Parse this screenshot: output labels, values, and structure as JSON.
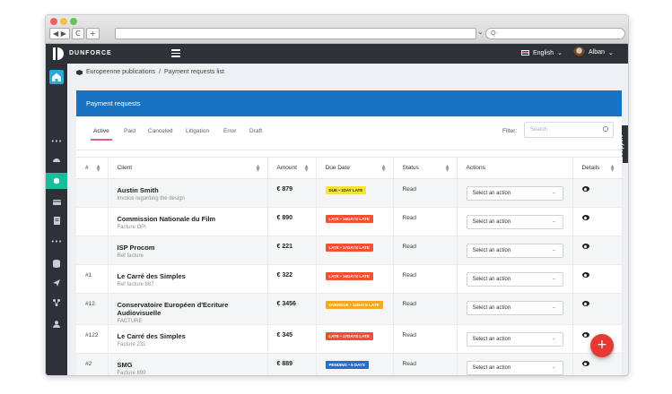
{
  "browser": {
    "back_label": "◀ ▶",
    "reload_label": "C",
    "new_tab_label": "+",
    "url_marker": "⌄",
    "search_placeholder": "Q-"
  },
  "topnav": {
    "brand": "DUNFORCE",
    "language": "English",
    "user": "Alban"
  },
  "sidebar": {
    "items": [
      "home",
      "more",
      "dashboard",
      "publications",
      "billing",
      "documents",
      "more",
      "database",
      "send",
      "network",
      "users"
    ]
  },
  "support": "Support",
  "breadcrumb": {
    "parent": "Europeenne publications",
    "separator": "/",
    "current": "Payment requests list"
  },
  "panel": {
    "title": "Payment requests",
    "tabs": [
      "Active",
      "Paid",
      "Canceled",
      "Litigation",
      "Error",
      "Draft"
    ],
    "active_tab": "Active",
    "filter_label": "Filter:",
    "filter_placeholder": "Search"
  },
  "table": {
    "headers": [
      "#",
      "Client",
      "Amount",
      "Due Date",
      "Status",
      "Actions",
      "Details"
    ],
    "rows": [
      {
        "num": "",
        "client": "Austin Smith",
        "sub": "Invoice regarding the design",
        "amount": "€ 879",
        "due": "DUE • 1DAY LATE",
        "due_color": "#f5e23a",
        "due_text_color": "#333333",
        "status": "Read",
        "action": "Select an action"
      },
      {
        "num": "",
        "client": "Commission Nationale du Film",
        "sub": "Facture OPI",
        "amount": "€ 890",
        "due": "LATE • 16DAYS LATE",
        "due_color": "#f2502e",
        "due_text_color": "#ffffff",
        "status": "Read",
        "action": "Select an action"
      },
      {
        "num": "",
        "client": "ISP Procom",
        "sub": "Ref facture",
        "amount": "€ 221",
        "due": "LATE • 17DAYS LATE",
        "due_color": "#f2502e",
        "due_text_color": "#ffffff",
        "status": "Read",
        "action": "Select an action"
      },
      {
        "num": "#1",
        "client": "Le Carré des Simples",
        "sub": "Ref facture 987",
        "amount": "€ 322",
        "due": "LATE • 16DAYS LATE",
        "due_color": "#f2502e",
        "due_text_color": "#ffffff",
        "status": "Read",
        "action": "Select an action"
      },
      {
        "num": "#12",
        "client": "Conservatoire Européen d'Ecriture Audiovisuelle",
        "sub": "FACTURE",
        "amount": "€ 3456",
        "due": "OVERDUE • 12DAYS LATE",
        "due_color": "#f5a623",
        "due_text_color": "#ffffff",
        "status": "Read",
        "action": "Select an action"
      },
      {
        "num": "#122",
        "client": "Le Carré des Simples",
        "sub": "Facture 231",
        "amount": "€ 345",
        "due": "LATE • 17DAYS LATE",
        "due_color": "#f2502e",
        "due_text_color": "#ffffff",
        "status": "Read",
        "action": "Select an action"
      },
      {
        "num": "#2",
        "client": "SMG",
        "sub": "Facture 899",
        "amount": "€ 889",
        "due": "PENDING • 5 DAYS",
        "due_color": "#1f6fd1",
        "due_text_color": "#ffffff",
        "status": "Read",
        "action": "Select an action"
      }
    ]
  },
  "fab_label": "+"
}
